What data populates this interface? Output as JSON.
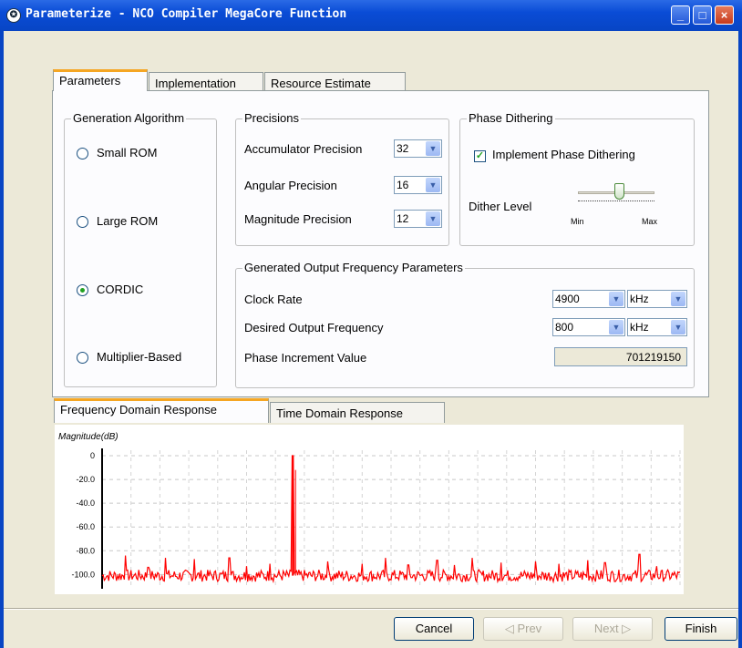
{
  "window": {
    "title": "Parameterize - NCO Compiler MegaCore Function",
    "controls": [
      "_",
      "□",
      "×"
    ]
  },
  "tabs": [
    "Parameters",
    "Implementation",
    "Resource Estimate"
  ],
  "generation_algorithm": {
    "label": "Generation Algorithm",
    "options": [
      "Small ROM",
      "Large ROM",
      "CORDIC",
      "Multiplier-Based"
    ],
    "selected": "CORDIC"
  },
  "precisions": {
    "label": "Precisions",
    "accumulator": {
      "label": "Accumulator Precision",
      "value": "32"
    },
    "angular": {
      "label": "Angular Precision",
      "value": "16"
    },
    "magnitude": {
      "label": "Magnitude Precision",
      "value": "12"
    }
  },
  "phase_dithering": {
    "label": "Phase Dithering",
    "implement_label": "Implement Phase Dithering",
    "implement_checked": true,
    "dither_level_label": "Dither Level",
    "min_label": "Min",
    "max_label": "Max",
    "dither_level_fraction": 0.55
  },
  "output_frequency": {
    "label": "Generated Output Frequency Parameters",
    "clock_rate": {
      "label": "Clock Rate",
      "value": "4900",
      "unit": "kHz"
    },
    "desired_output": {
      "label": "Desired Output Frequency",
      "value": "800",
      "unit": "kHz"
    },
    "phase_increment": {
      "label": "Phase Increment Value",
      "value": "701219150"
    }
  },
  "response_tabs": [
    "Frequency Domain Response",
    "Time Domain Response"
  ],
  "buttons": {
    "cancel": "Cancel",
    "prev": "◁ Prev",
    "next": "Next ▷",
    "finish": "Finish"
  },
  "chart_data": {
    "type": "line",
    "ylabel": "Magnitude(dB)",
    "yticks": [
      "0",
      "-20.0",
      "-40.0",
      "-60.0",
      "-80.0",
      "-100.0"
    ],
    "ylim": [
      -112,
      0
    ],
    "grid": true,
    "series_color": "#ff0000",
    "noise_floor": -101,
    "peak": {
      "x": 0.33,
      "y": 0
    },
    "spurs": [
      {
        "x": 0.04,
        "y": -84
      },
      {
        "x": 0.08,
        "y": -94
      },
      {
        "x": 0.11,
        "y": -86
      },
      {
        "x": 0.16,
        "y": -87
      },
      {
        "x": 0.22,
        "y": -86
      },
      {
        "x": 0.25,
        "y": -93
      },
      {
        "x": 0.29,
        "y": -91
      },
      {
        "x": 0.39,
        "y": -89
      },
      {
        "x": 0.45,
        "y": -91
      },
      {
        "x": 0.49,
        "y": -86
      },
      {
        "x": 0.53,
        "y": -92
      },
      {
        "x": 0.58,
        "y": -88
      },
      {
        "x": 0.61,
        "y": -92
      },
      {
        "x": 0.64,
        "y": -86
      },
      {
        "x": 0.69,
        "y": -90
      },
      {
        "x": 0.75,
        "y": -89
      },
      {
        "x": 0.79,
        "y": -91
      },
      {
        "x": 0.84,
        "y": -88
      },
      {
        "x": 0.87,
        "y": -90
      },
      {
        "x": 0.93,
        "y": -83
      },
      {
        "x": 0.96,
        "y": -93
      }
    ]
  }
}
